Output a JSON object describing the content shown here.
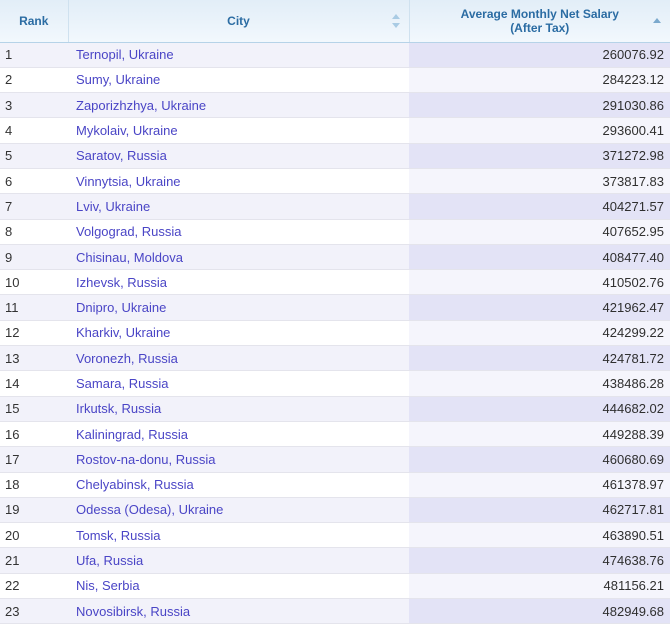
{
  "table": {
    "name": "cost-of-living-average-monthly-net-salary-ranking",
    "columns": [
      {
        "key": "rank",
        "label": "Rank",
        "sort": "none",
        "sort_icon": "sort-updown-icon"
      },
      {
        "key": "city",
        "label": "City",
        "sort": "none",
        "sort_icon": "sort-updown-icon"
      },
      {
        "key": "salary",
        "label_line1": "Average Monthly Net Salary",
        "label_line2": "(After Tax)",
        "sort": "ascending",
        "sort_icon": "sort-ascending-icon"
      }
    ],
    "rows": [
      {
        "rank": "1",
        "city": "Ternopil, Ukraine",
        "salary": "260076.92"
      },
      {
        "rank": "2",
        "city": "Sumy, Ukraine",
        "salary": "284223.12"
      },
      {
        "rank": "3",
        "city": "Zaporizhzhya, Ukraine",
        "salary": "291030.86"
      },
      {
        "rank": "4",
        "city": "Mykolaiv, Ukraine",
        "salary": "293600.41"
      },
      {
        "rank": "5",
        "city": "Saratov, Russia",
        "salary": "371272.98"
      },
      {
        "rank": "6",
        "city": "Vinnytsia, Ukraine",
        "salary": "373817.83"
      },
      {
        "rank": "7",
        "city": "Lviv, Ukraine",
        "salary": "404271.57"
      },
      {
        "rank": "8",
        "city": "Volgograd, Russia",
        "salary": "407652.95"
      },
      {
        "rank": "9",
        "city": "Chisinau, Moldova",
        "salary": "408477.40"
      },
      {
        "rank": "10",
        "city": "Izhevsk, Russia",
        "salary": "410502.76"
      },
      {
        "rank": "11",
        "city": "Dnipro, Ukraine",
        "salary": "421962.47"
      },
      {
        "rank": "12",
        "city": "Kharkiv, Ukraine",
        "salary": "424299.22"
      },
      {
        "rank": "13",
        "city": "Voronezh, Russia",
        "salary": "424781.72"
      },
      {
        "rank": "14",
        "city": "Samara, Russia",
        "salary": "438486.28"
      },
      {
        "rank": "15",
        "city": "Irkutsk, Russia",
        "salary": "444682.02"
      },
      {
        "rank": "16",
        "city": "Kaliningrad, Russia",
        "salary": "449288.39"
      },
      {
        "rank": "17",
        "city": "Rostov-na-donu, Russia",
        "salary": "460680.69"
      },
      {
        "rank": "18",
        "city": "Chelyabinsk, Russia",
        "salary": "461378.97"
      },
      {
        "rank": "19",
        "city": "Odessa (Odesa), Ukraine",
        "salary": "462717.81"
      },
      {
        "rank": "20",
        "city": "Tomsk, Russia",
        "salary": "463890.51"
      },
      {
        "rank": "21",
        "city": "Ufa, Russia",
        "salary": "474638.76"
      },
      {
        "rank": "22",
        "city": "Nis, Serbia",
        "salary": "481156.21"
      },
      {
        "rank": "23",
        "city": "Novosibirsk, Russia",
        "salary": "482949.68"
      }
    ]
  },
  "colors": {
    "header_text": "#2b6ca3",
    "header_bg_top": "#e2eef8",
    "header_bg_bottom": "#f2f8fd",
    "city_link": "#4a45c6",
    "row_tint_rank_city": "#f2f2fa",
    "row_tint_salary": "#e3e3f6",
    "row_alt_salary": "#f5f5fc",
    "row_border": "#e4e4ec"
  }
}
